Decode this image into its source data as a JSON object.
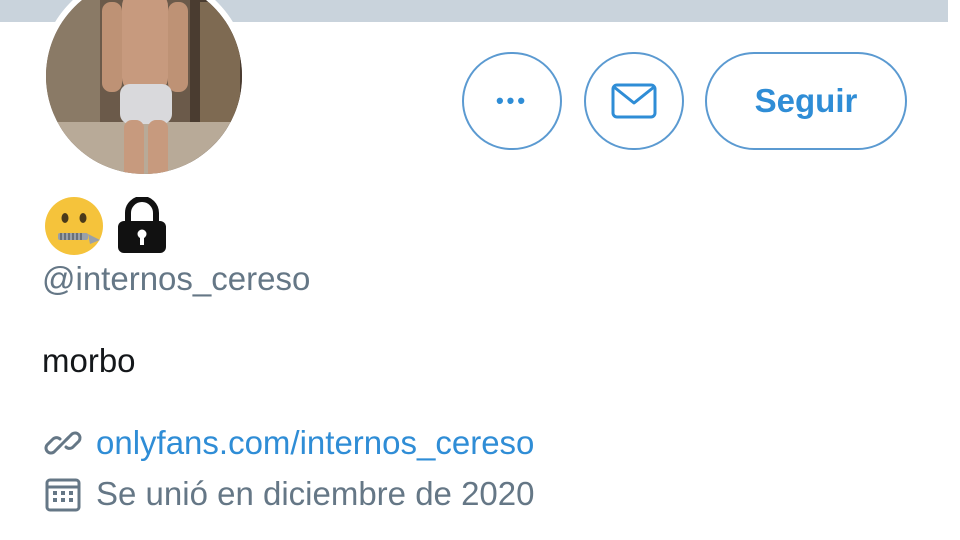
{
  "profile": {
    "handle": "@internos_cereso",
    "bio": "morbo",
    "link": "onlyfans.com/internos_cereso",
    "joined": "Se unió en diciembre de 2020",
    "name_emojis": [
      "zipper-mouth-face-icon",
      "lock-icon"
    ]
  },
  "actions": {
    "more_label": "•••",
    "follow_label": "Seguir"
  },
  "colors": {
    "accent": "#2f8dd6",
    "button_border": "#5b9ad1",
    "secondary_text": "#657786",
    "banner": "#c9d3dc"
  }
}
